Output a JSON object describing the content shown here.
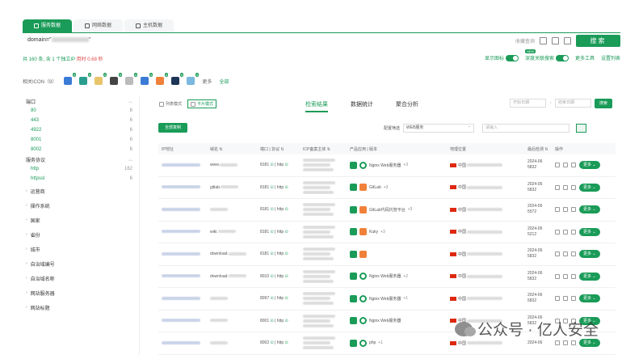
{
  "tabs": [
    {
      "label": "服务数据",
      "active": true
    },
    {
      "label": "网络数据",
      "active": false
    },
    {
      "label": "主机数据",
      "active": false
    }
  ],
  "search": {
    "query_prefix": "domain=\"",
    "query_suffix": "\"",
    "fav_label": "收藏查询",
    "submit_label": "搜索"
  },
  "stats": {
    "prefix": "共",
    "total": "160",
    "mid": "条, 含 1 个独立IP",
    "time": "用时 0.68 秒"
  },
  "toggles": {
    "show_favicon": "显示图标",
    "deep_search": "深度关联搜索",
    "new_badge": "NEW",
    "more_tools": "更多工具",
    "settings": "设置列表"
  },
  "icon_row": {
    "label": "相关ICON（9）",
    "badges": [
      "6",
      "6",
      "6",
      "6",
      "6",
      "6",
      "6",
      "6",
      "6"
    ],
    "more": "更多",
    "all": "全部"
  },
  "sidebar": {
    "port_group": "端口",
    "ports": [
      {
        "label": "80",
        "count": "6"
      },
      {
        "label": "443",
        "count": "6"
      },
      {
        "label": "4922",
        "count": "6"
      },
      {
        "label": "8001",
        "count": "6"
      },
      {
        "label": "8002",
        "count": "6"
      }
    ],
    "protocol_group": "服务协议",
    "protocols": [
      {
        "label": "http",
        "count": "162"
      },
      {
        "label": "httpssl",
        "count": "6"
      }
    ],
    "collapsed": [
      "运营商",
      "操作系统",
      "国家",
      "省份",
      "城市",
      "自治域编号",
      "自治域名称",
      "网站服务器",
      "网站标题"
    ]
  },
  "main": {
    "view_list": "列表模式",
    "view_card": "卡片模式",
    "result_tabs": [
      "检索结果",
      "数据统计",
      "聚合分析"
    ],
    "date_start": "开始日期",
    "date_end": "结束日期",
    "go": "搜索",
    "copy_all": "全部复制",
    "match_label": "配置筛选",
    "match_value": "WEB服务",
    "filter_placeholder": "请输入"
  },
  "table": {
    "headers": [
      "IP地址",
      "域名 ⇅",
      "端口 | 协议 ⇅",
      "ICP备案主体 ⇅",
      "产品应用 | 版本",
      "地理位置",
      "最后检测 ⇅",
      "操作"
    ],
    "rows": [
      {
        "domain": "www.",
        "port": "8181",
        "proto": "http",
        "products": [
          {
            "icon": "green",
            "name": "Nginx Web服务器"
          }
        ],
        "more": "+3",
        "geo": "中国",
        "date": "2024-06",
        "time": "5832"
      },
      {
        "domain": "gitlab.",
        "port": "8181",
        "proto": "http",
        "products": [
          {
            "icon": "fox",
            "name": "GitLab"
          }
        ],
        "more": "+3",
        "geo": "中国",
        "date": "2024-06",
        "time": "5832"
      },
      {
        "domain": "",
        "port": "8181",
        "proto": "http",
        "products": [
          {
            "icon": "fox",
            "name": "GitLab代码托管平台"
          }
        ],
        "more": "+3",
        "geo": "中国",
        "date": "2024-06",
        "time": "5572"
      },
      {
        "domain": "wiki.",
        "port": "8181",
        "proto": "http",
        "products": [
          {
            "icon": "fox",
            "name": "Kuky"
          }
        ],
        "more": "+3",
        "geo": "中国",
        "date": "2024-06",
        "time": "5212"
      },
      {
        "domain": "download.",
        "port": "8181",
        "proto": "http",
        "products": [
          {
            "icon": "fox",
            "name": ""
          }
        ],
        "more": "",
        "geo": "中国",
        "date": "2024-06",
        "time": "5832"
      },
      {
        "domain": "download.",
        "port": "8010",
        "proto": "http",
        "products": [
          {
            "icon": "green",
            "name": "Nginx Web服务器"
          }
        ],
        "more": "+2",
        "geo": "中国",
        "date": "2024-06",
        "time": "5832"
      },
      {
        "domain": "",
        "port": "8097",
        "proto": "http",
        "products": [
          {
            "icon": "green",
            "name": "Nginx Web服务器"
          }
        ],
        "more": "+1",
        "geo": "中国",
        "date": "2024-06",
        "time": "5832"
      },
      {
        "domain": "",
        "port": "8001",
        "proto": "http",
        "products": [
          {
            "icon": "green",
            "name": "Nginx Web服务器"
          }
        ],
        "more": "",
        "geo": "中国",
        "date": "2024-06",
        "time": "5832"
      },
      {
        "domain": "",
        "port": "8002",
        "proto": "http",
        "products": [
          {
            "icon": "green",
            "name": "php"
          }
        ],
        "more": "+1",
        "geo": "中国",
        "date": "2024-06",
        "time": ""
      }
    ],
    "more_label": "更多 ⌄"
  },
  "watermark": "公众号 · 亿人安全",
  "colors": {
    "accent": "#1a9b58",
    "danger": "#e14a4a"
  }
}
